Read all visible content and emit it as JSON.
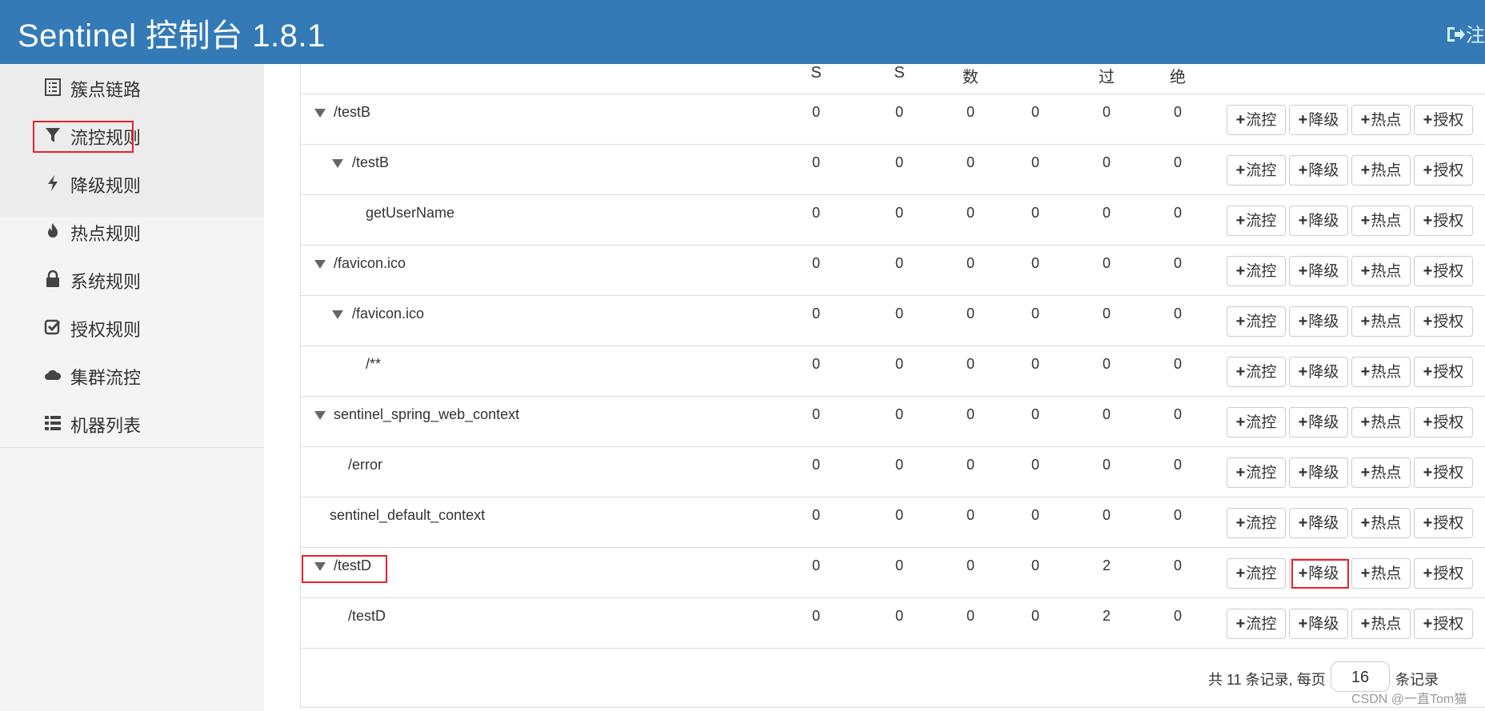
{
  "header": {
    "title": "Sentinel 控制台 1.8.1",
    "logout_label": "注"
  },
  "sidebar": {
    "items": [
      {
        "label": "簇点链路",
        "icon": "list-icon"
      },
      {
        "label": "流控规则",
        "icon": "filter-icon"
      },
      {
        "label": "降级规则",
        "icon": "flash-icon"
      },
      {
        "label": "热点规则",
        "icon": "fire-icon"
      },
      {
        "label": "系统规则",
        "icon": "lock-icon"
      },
      {
        "label": "授权规则",
        "icon": "check-icon"
      },
      {
        "label": "集群流控",
        "icon": "cloud-icon"
      },
      {
        "label": "机器列表",
        "icon": "list-bullet-icon"
      }
    ]
  },
  "table": {
    "headers": [
      "S",
      "S",
      "数",
      "过",
      "绝"
    ],
    "button_labels": [
      "流控",
      "降级",
      "热点",
      "授权"
    ],
    "rows": [
      {
        "name": "/testB",
        "expandable": true,
        "values": [
          "0",
          "0",
          "0",
          "0",
          "0",
          "0"
        ]
      },
      {
        "name": "/testB",
        "expandable": true,
        "values": [
          "0",
          "0",
          "0",
          "0",
          "0",
          "0"
        ]
      },
      {
        "name": "getUserName",
        "expandable": false,
        "values": [
          "0",
          "0",
          "0",
          "0",
          "0",
          "0"
        ]
      },
      {
        "name": "/favicon.ico",
        "expandable": true,
        "values": [
          "0",
          "0",
          "0",
          "0",
          "0",
          "0"
        ]
      },
      {
        "name": "/favicon.ico",
        "expandable": true,
        "values": [
          "0",
          "0",
          "0",
          "0",
          "0",
          "0"
        ]
      },
      {
        "name": "/**",
        "expandable": false,
        "values": [
          "0",
          "0",
          "0",
          "0",
          "0",
          "0"
        ]
      },
      {
        "name": "sentinel_spring_web_context",
        "expandable": true,
        "values": [
          "0",
          "0",
          "0",
          "0",
          "0",
          "0"
        ]
      },
      {
        "name": "/error",
        "expandable": false,
        "values": [
          "0",
          "0",
          "0",
          "0",
          "0",
          "0"
        ]
      },
      {
        "name": "sentinel_default_context",
        "expandable": false,
        "values": [
          "0",
          "0",
          "0",
          "0",
          "0",
          "0"
        ]
      },
      {
        "name": "/testD",
        "expandable": true,
        "values": [
          "0",
          "0",
          "0",
          "0",
          "2",
          "0"
        ]
      },
      {
        "name": "/testD",
        "expandable": false,
        "values": [
          "0",
          "0",
          "0",
          "0",
          "2",
          "0"
        ]
      }
    ]
  },
  "pagination": {
    "prefix": "共 11 条记录, 每页",
    "page_size": "16",
    "suffix": "条记录"
  },
  "watermark": "CSDN @一直Tom猫",
  "colors": {
    "header_bg": "#337ab7",
    "highlight_red": "#e8202a"
  }
}
